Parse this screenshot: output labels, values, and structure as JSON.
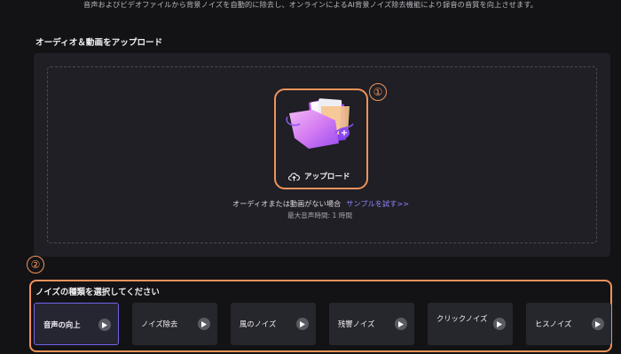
{
  "description": "音声およびビデオファイルから背景ノイズを自動的に除去し、オンラインによるAI背景ノイズ除去機能により録音の音質を向上させます。",
  "upload_section": {
    "title": "オーディオ＆動画をアップロード",
    "upload_button_label": "アップロード",
    "no_audio_text": "オーディオまたは動画がない場合",
    "sample_link": "サンプルを試す>>",
    "max_duration": "最大音声時間: 1 時間"
  },
  "annotations": {
    "badge1": "①",
    "badge2": "②"
  },
  "noise_section": {
    "title": "ノイズの種類を選択してください",
    "selected": "音声の向上",
    "options": [
      {
        "label": "音声の向上"
      },
      {
        "label": "ノイズ除去"
      },
      {
        "label": "風のノイズ"
      },
      {
        "label": "残響ノイズ"
      },
      {
        "label": "クリックノイズ"
      },
      {
        "label": "ヒスノイズ"
      }
    ]
  },
  "colors": {
    "background": "#131316",
    "panel": "#1f1f25",
    "accent": "#8f85ff",
    "highlight": "#f0935a",
    "selected_border": "#6f63e8"
  },
  "icons": [
    "folder-illustration",
    "upload-cloud-icon",
    "play-icon"
  ]
}
